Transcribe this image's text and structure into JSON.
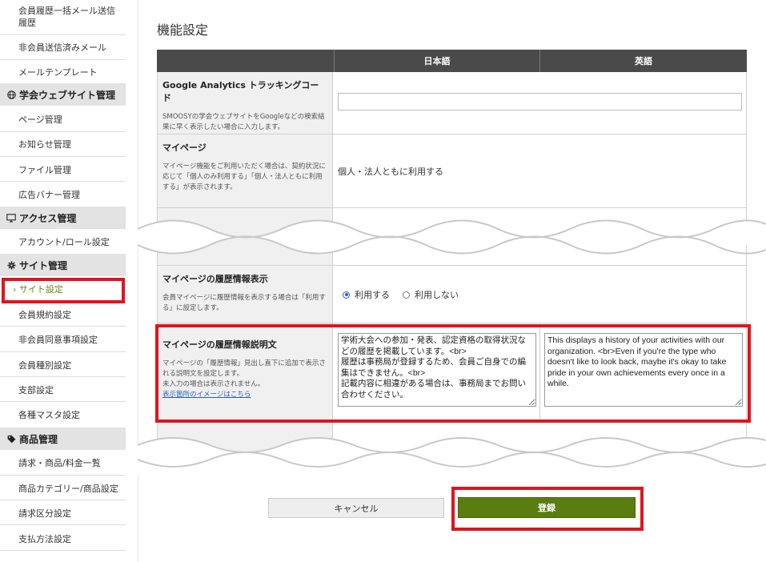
{
  "sidebar": {
    "items_top": [
      {
        "label": "会員履歴一括メール送信履歴"
      },
      {
        "label": "非会員送信済みメール"
      },
      {
        "label": "メールテンプレート"
      }
    ],
    "sections": [
      {
        "title": "学会ウェブサイト管理",
        "icon": "globe-icon",
        "items": [
          "ページ管理",
          "お知らせ管理",
          "ファイル管理",
          "広告バナー管理"
        ]
      },
      {
        "title": "アクセス管理",
        "icon": "monitor-icon",
        "items": [
          "アカウント/ロール設定"
        ]
      },
      {
        "title": "サイト管理",
        "icon": "gear-icon",
        "items": [
          "サイト設定",
          "会員規約設定",
          "非会員同意事項設定",
          "会員種別設定",
          "支部設定",
          "各種マスタ設定"
        ]
      },
      {
        "title": "商品管理",
        "icon": "tag-icon",
        "items": [
          "請求・商品/料金一覧",
          "商品カテゴリー/商品設定",
          "請求区分設定",
          "支払方法設定"
        ]
      }
    ],
    "active_item": "サイト設定"
  },
  "main": {
    "title": "機能設定",
    "columns": [
      "日本語",
      "英語"
    ],
    "rows": {
      "ga": {
        "title": "Google Analytics トラッキングコード",
        "desc": "SMOOSYの学会ウェブサイトをGoogleなどの検索結果に早く表示したい場合に入力します。",
        "value": ""
      },
      "mypage": {
        "title": "マイページ",
        "desc": "マイページ機能をご利用いただく場合は、契約状況に応じて「個人のみ利用する」「個人・法人ともに利用する」が表示されます。",
        "value": "個人・法人ともに利用する"
      },
      "history_display": {
        "title": "マイページの履歴情報表示",
        "desc": "会員マイページに履歴情報を表示する場合は「利用する」に設定します。",
        "options": [
          "利用する",
          "利用しない"
        ],
        "selected": "利用する"
      },
      "history_desc": {
        "title": "マイページの履歴情報説明文",
        "desc1": "マイページの「履歴情報」見出し直下に追加で表示される説明文を設定します。",
        "desc2": "未入力の場合は表示されません。",
        "link": "表示箇所のイメージはこちら",
        "value_ja": "学術大会への参加・発表、認定資格の取得状況などの履歴を掲載しています。<br>\n履歴は事務局が登録するため、会員ご自身での編集はできません。<br>\n記載内容に相違がある場合は、事務局までお問い合わせください。",
        "value_en": "This displays a history of your activities with our organization. <br>Even if you're the type who doesn't like to look back, maybe it's okay to take pride in your own achievements every once in a while."
      }
    },
    "buttons": {
      "cancel": "キャンセル",
      "save": "登録"
    }
  },
  "colors": {
    "accent_red": "#e0141e",
    "save_green": "#5a7d10",
    "header_dark": "#4a4a4a"
  }
}
